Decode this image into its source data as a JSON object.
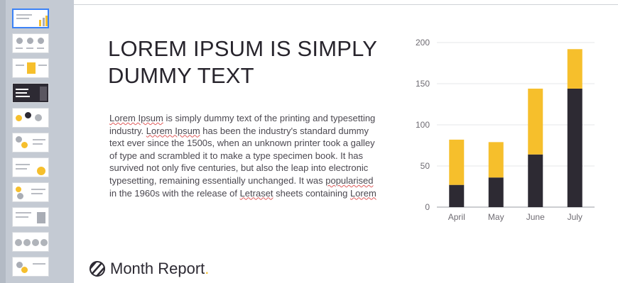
{
  "slide": {
    "title": "LOREM IPSUM IS SIMPLY DUMMY TEXT",
    "body_parts": [
      "Lorem Ipsum",
      " is simply dummy text of the printing and typesetting industry. ",
      "Lorem Ipsum",
      " has been the industry's standard dummy text ever since the 1500s, when an unknown printer took a galley of type and scrambled it to make a type specimen book. It has survived not only five centuries, but also the leap into electronic typesetting, remaining essentially unchanged. It was ",
      "popularised",
      " in the 1960s with the release of ",
      "Letraset",
      " sheets containing ",
      "Lorem"
    ],
    "footer_label": "Month Report",
    "footer_dot": "."
  },
  "colors": {
    "accent_yellow": "#f6bf2c",
    "dark": "#2d2a33",
    "selection_blue": "#3b82f6",
    "sidebar_bg": "#c4cad3"
  },
  "icons": {
    "footer_logo": "striped-circle-logo-icon"
  },
  "chart_data": {
    "type": "bar",
    "stacked": true,
    "categories": [
      "April",
      "May",
      "June",
      "July"
    ],
    "series": [
      {
        "values": [
          27,
          36,
          64,
          144
        ],
        "color": "#2d2a33"
      },
      {
        "values": [
          55,
          43,
          80,
          48
        ],
        "color": "#f6bf2c"
      }
    ],
    "ylim": [
      0,
      200
    ],
    "yticks": [
      0,
      50,
      100,
      150,
      200
    ],
    "grid": true,
    "legend": "none"
  }
}
